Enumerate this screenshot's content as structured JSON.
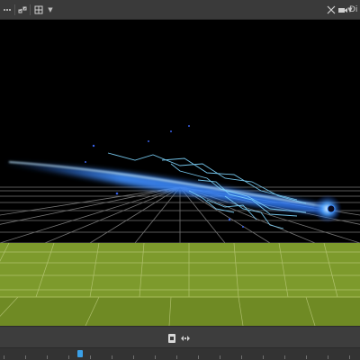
{
  "toolbar": {
    "left_icons": [
      "dots-icon",
      "link-icon",
      "grid-icon",
      "dropdown-icon"
    ],
    "right_icons": [
      "crosshair-icon",
      "camera-icon",
      "dropdown-icon"
    ],
    "right_label": "Di"
  },
  "viewport": {
    "scene": "lightning-effect",
    "colors": {
      "background": "#000000",
      "grid": "#8a8a8a",
      "ground_top": "#7d9a2c",
      "ground_front": "#6f8a24",
      "beam_core": "#dff3ff",
      "beam_glow": "#2f7bff",
      "bolts": "#7fd6ff"
    }
  },
  "bottom_bar": {
    "icons": [
      "frame-icon",
      "step-icon"
    ],
    "playhead_label": ""
  }
}
